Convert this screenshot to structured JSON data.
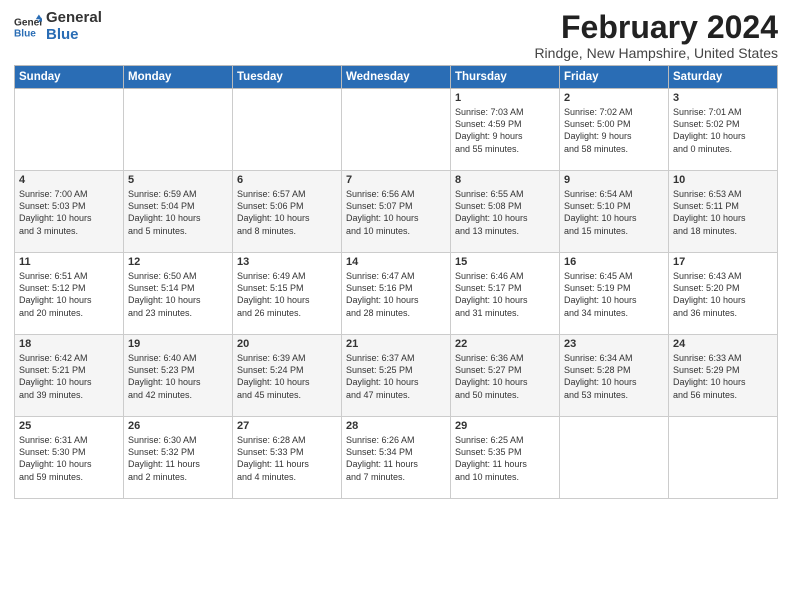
{
  "logo": {
    "line1": "General",
    "line2": "Blue"
  },
  "title": "February 2024",
  "subtitle": "Rindge, New Hampshire, United States",
  "days_of_week": [
    "Sunday",
    "Monday",
    "Tuesday",
    "Wednesday",
    "Thursday",
    "Friday",
    "Saturday"
  ],
  "weeks": [
    [
      {
        "day": "",
        "info": ""
      },
      {
        "day": "",
        "info": ""
      },
      {
        "day": "",
        "info": ""
      },
      {
        "day": "",
        "info": ""
      },
      {
        "day": "1",
        "info": "Sunrise: 7:03 AM\nSunset: 4:59 PM\nDaylight: 9 hours\nand 55 minutes."
      },
      {
        "day": "2",
        "info": "Sunrise: 7:02 AM\nSunset: 5:00 PM\nDaylight: 9 hours\nand 58 minutes."
      },
      {
        "day": "3",
        "info": "Sunrise: 7:01 AM\nSunset: 5:02 PM\nDaylight: 10 hours\nand 0 minutes."
      }
    ],
    [
      {
        "day": "4",
        "info": "Sunrise: 7:00 AM\nSunset: 5:03 PM\nDaylight: 10 hours\nand 3 minutes."
      },
      {
        "day": "5",
        "info": "Sunrise: 6:59 AM\nSunset: 5:04 PM\nDaylight: 10 hours\nand 5 minutes."
      },
      {
        "day": "6",
        "info": "Sunrise: 6:57 AM\nSunset: 5:06 PM\nDaylight: 10 hours\nand 8 minutes."
      },
      {
        "day": "7",
        "info": "Sunrise: 6:56 AM\nSunset: 5:07 PM\nDaylight: 10 hours\nand 10 minutes."
      },
      {
        "day": "8",
        "info": "Sunrise: 6:55 AM\nSunset: 5:08 PM\nDaylight: 10 hours\nand 13 minutes."
      },
      {
        "day": "9",
        "info": "Sunrise: 6:54 AM\nSunset: 5:10 PM\nDaylight: 10 hours\nand 15 minutes."
      },
      {
        "day": "10",
        "info": "Sunrise: 6:53 AM\nSunset: 5:11 PM\nDaylight: 10 hours\nand 18 minutes."
      }
    ],
    [
      {
        "day": "11",
        "info": "Sunrise: 6:51 AM\nSunset: 5:12 PM\nDaylight: 10 hours\nand 20 minutes."
      },
      {
        "day": "12",
        "info": "Sunrise: 6:50 AM\nSunset: 5:14 PM\nDaylight: 10 hours\nand 23 minutes."
      },
      {
        "day": "13",
        "info": "Sunrise: 6:49 AM\nSunset: 5:15 PM\nDaylight: 10 hours\nand 26 minutes."
      },
      {
        "day": "14",
        "info": "Sunrise: 6:47 AM\nSunset: 5:16 PM\nDaylight: 10 hours\nand 28 minutes."
      },
      {
        "day": "15",
        "info": "Sunrise: 6:46 AM\nSunset: 5:17 PM\nDaylight: 10 hours\nand 31 minutes."
      },
      {
        "day": "16",
        "info": "Sunrise: 6:45 AM\nSunset: 5:19 PM\nDaylight: 10 hours\nand 34 minutes."
      },
      {
        "day": "17",
        "info": "Sunrise: 6:43 AM\nSunset: 5:20 PM\nDaylight: 10 hours\nand 36 minutes."
      }
    ],
    [
      {
        "day": "18",
        "info": "Sunrise: 6:42 AM\nSunset: 5:21 PM\nDaylight: 10 hours\nand 39 minutes."
      },
      {
        "day": "19",
        "info": "Sunrise: 6:40 AM\nSunset: 5:23 PM\nDaylight: 10 hours\nand 42 minutes."
      },
      {
        "day": "20",
        "info": "Sunrise: 6:39 AM\nSunset: 5:24 PM\nDaylight: 10 hours\nand 45 minutes."
      },
      {
        "day": "21",
        "info": "Sunrise: 6:37 AM\nSunset: 5:25 PM\nDaylight: 10 hours\nand 47 minutes."
      },
      {
        "day": "22",
        "info": "Sunrise: 6:36 AM\nSunset: 5:27 PM\nDaylight: 10 hours\nand 50 minutes."
      },
      {
        "day": "23",
        "info": "Sunrise: 6:34 AM\nSunset: 5:28 PM\nDaylight: 10 hours\nand 53 minutes."
      },
      {
        "day": "24",
        "info": "Sunrise: 6:33 AM\nSunset: 5:29 PM\nDaylight: 10 hours\nand 56 minutes."
      }
    ],
    [
      {
        "day": "25",
        "info": "Sunrise: 6:31 AM\nSunset: 5:30 PM\nDaylight: 10 hours\nand 59 minutes."
      },
      {
        "day": "26",
        "info": "Sunrise: 6:30 AM\nSunset: 5:32 PM\nDaylight: 11 hours\nand 2 minutes."
      },
      {
        "day": "27",
        "info": "Sunrise: 6:28 AM\nSunset: 5:33 PM\nDaylight: 11 hours\nand 4 minutes."
      },
      {
        "day": "28",
        "info": "Sunrise: 6:26 AM\nSunset: 5:34 PM\nDaylight: 11 hours\nand 7 minutes."
      },
      {
        "day": "29",
        "info": "Sunrise: 6:25 AM\nSunset: 5:35 PM\nDaylight: 11 hours\nand 10 minutes."
      },
      {
        "day": "",
        "info": ""
      },
      {
        "day": "",
        "info": ""
      }
    ]
  ]
}
